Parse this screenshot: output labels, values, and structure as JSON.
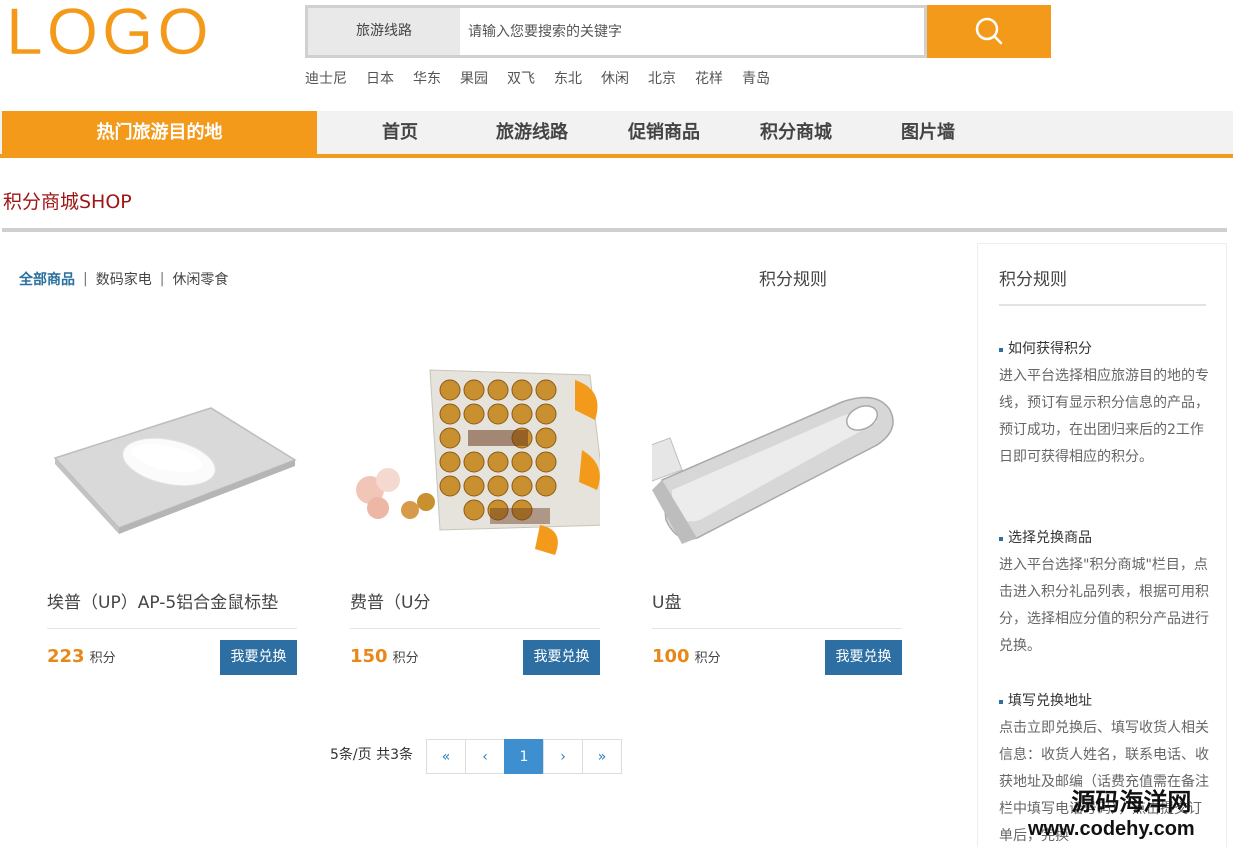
{
  "header": {
    "logo_text": "LOGO",
    "search_category": "旅游线路",
    "search_placeholder": "请输入您要搜索的关键字",
    "hot_words": [
      "迪士尼",
      "日本",
      "华东",
      "果园",
      "双飞",
      "东北",
      "休闲",
      "北京",
      "花样",
      "青岛"
    ]
  },
  "nav": {
    "hot_destination": "热门旅游目的地",
    "items": [
      "首页",
      "旅游线路",
      "促销商品",
      "积分商城",
      "图片墙"
    ]
  },
  "page": {
    "title": "积分商城SHOP",
    "tabs": [
      "全部商品",
      "数码家电",
      "休闲零食"
    ],
    "ghost_title": "积分规则"
  },
  "products": [
    {
      "name": "埃普（UP）AP-5铝合金鼠标垫",
      "points": "223",
      "unit": "积分",
      "button": "我要兑换",
      "image": "mouse-pad"
    },
    {
      "name": "费普（U分",
      "points": "150",
      "unit": "积分",
      "button": "我要兑换",
      "image": "chocolates"
    },
    {
      "name": "U盘",
      "points": "100",
      "unit": "积分",
      "button": "我要兑换",
      "image": "usb-drive"
    }
  ],
  "pagination": {
    "info": "5条/页 共3条",
    "first": "«",
    "prev": "‹",
    "current": "1",
    "next": "›",
    "last": "»"
  },
  "rules": {
    "title": "积分规则",
    "sections": [
      {
        "heading": "如何获得积分",
        "text": "进入平台选择相应旅游目的地的专线，预订有显示积分信息的产品，预订成功，在出团归来后的2工作日即可获得相应的积分。"
      },
      {
        "heading": "选择兑换商品",
        "text": "进入平台选择\"积分商城\"栏目，点击进入积分礼品列表，根据可用积分，选择相应分值的积分产品进行兑换。"
      },
      {
        "heading": "填写兑换地址",
        "text": "点击立即兑换后、填写收货人相关信息：收货人姓名，联系电话、收获地址及邮编（话费充值需在备注栏中填写电话号码），点击提交订单后，完换"
      }
    ]
  },
  "watermark": {
    "line1": "源码海洋网",
    "line2": "www.codehy.com"
  },
  "colors": {
    "accent": "#f39a1b",
    "button": "#2d6fa3",
    "title": "#a01616",
    "points": "#e8881b"
  }
}
